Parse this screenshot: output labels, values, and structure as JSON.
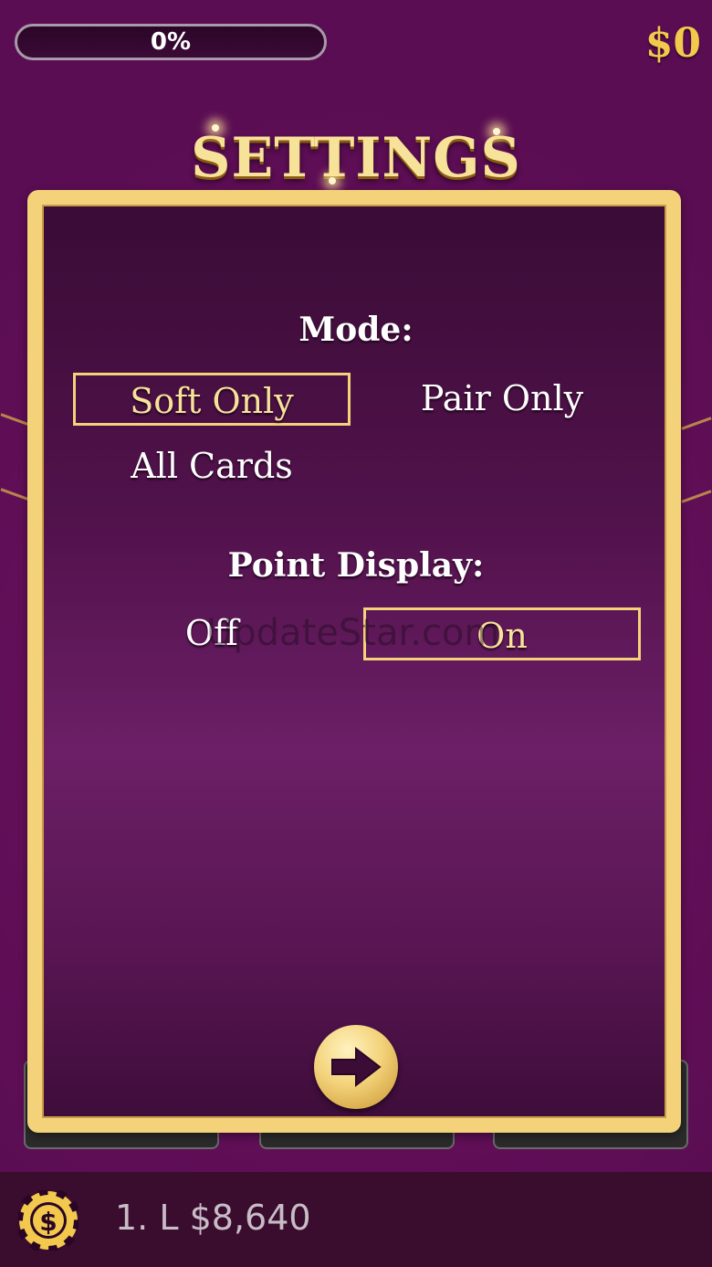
{
  "hud": {
    "progress_label": "0%",
    "progress_value": 0,
    "money": "$0"
  },
  "settings": {
    "title": "SETTINGS",
    "mode": {
      "heading": "Mode:",
      "options": [
        "Soft Only",
        "Pair Only",
        "All Cards"
      ],
      "selected": "Soft Only"
    },
    "point_display": {
      "heading": "Point Display:",
      "options": [
        "Off",
        "On"
      ],
      "selected": "On"
    },
    "next_icon": "right-arrow-icon"
  },
  "watermark": "UpdateStar.com",
  "footer": {
    "chip_icon": "dollar-chip-icon",
    "leader_text": "1. L $8,640"
  },
  "colors": {
    "background": "#620f58",
    "gold": "#f3d27a",
    "title_gold": "#f7e29a",
    "money_gold": "#f2c94c",
    "footer": "#3a0c2e"
  }
}
